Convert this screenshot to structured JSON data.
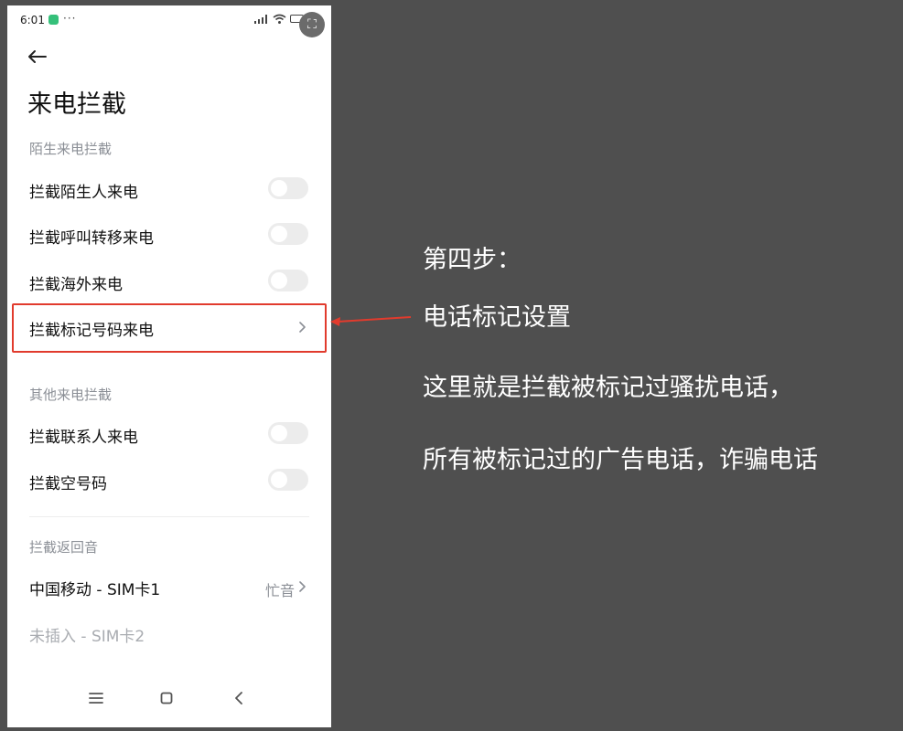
{
  "status_bar": {
    "time": "6:01",
    "more": "···"
  },
  "header": {
    "title": "来电拦截"
  },
  "sections": {
    "stranger": {
      "label": "陌生来电拦截",
      "items": [
        "拦截陌生人来电",
        "拦截呼叫转移来电",
        "拦截海外来电",
        "拦截标记号码来电"
      ]
    },
    "other": {
      "label": "其他来电拦截",
      "items": [
        "拦截联系人来电",
        "拦截空号码"
      ]
    },
    "return_tone": {
      "label": "拦截返回音",
      "items": [
        {
          "label": "中国移动 - SIM卡1",
          "value": "忙音"
        },
        {
          "label": "未插入 - SIM卡2"
        }
      ]
    }
  },
  "annotation": {
    "step": "第四步：",
    "line1": "电话标记设置",
    "line2": "这里就是拦截被标记过骚扰电话，",
    "line3": "所有被标记过的广告电话，诈骗电话"
  },
  "colors": {
    "highlight": "#e13b2d",
    "background": "#4f4f4f"
  },
  "icons": {
    "back": "arrow-left-icon",
    "chevron": "chevron-right-icon",
    "nav_menu": "menu-icon",
    "nav_home": "home-icon",
    "nav_back": "back-icon"
  }
}
